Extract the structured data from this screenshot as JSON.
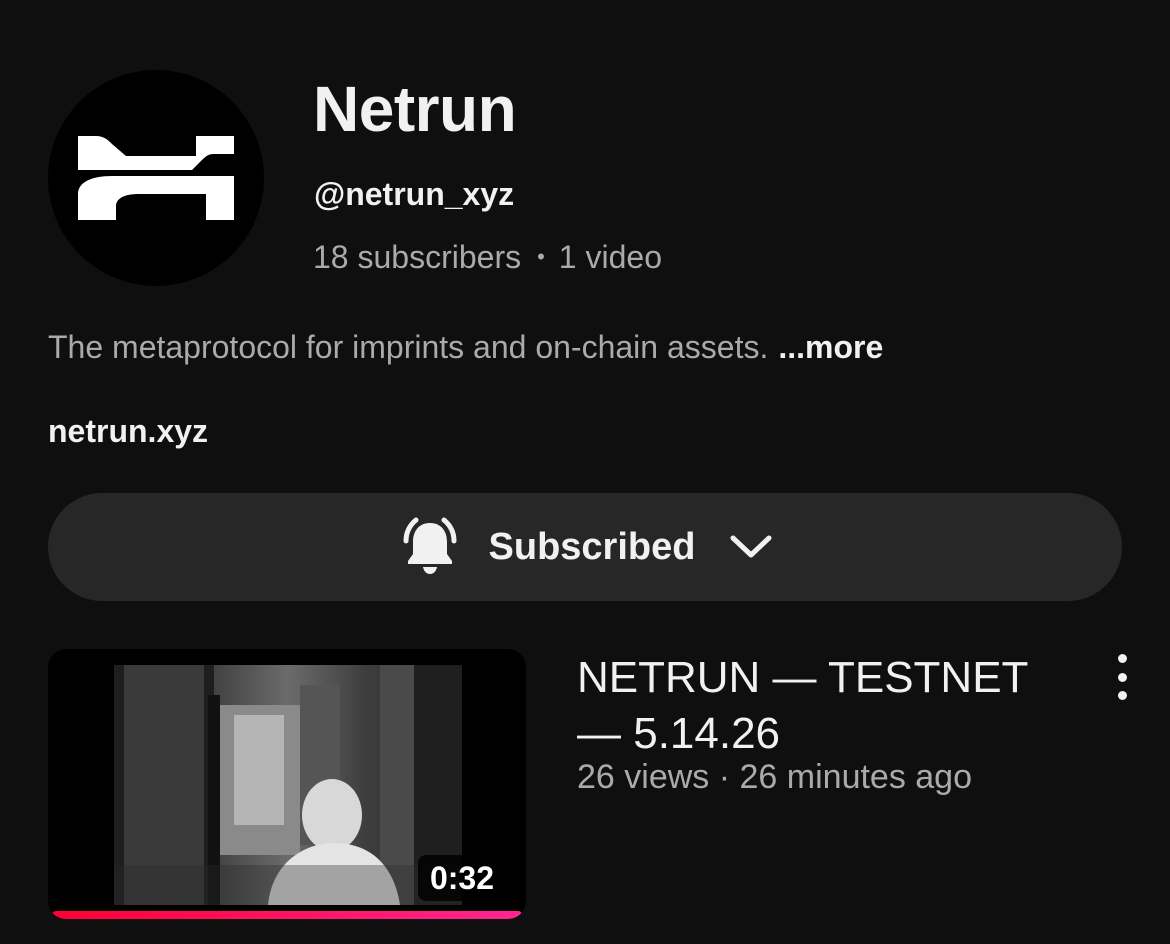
{
  "channel": {
    "name": "Netrun",
    "handle": "@netrun_xyz",
    "subscribers": "18 subscribers",
    "separator": "•",
    "videos": "1 video",
    "description": "The metaprotocol for imprints and on-chain assets.",
    "more_label": "...more",
    "link": "netrun.xyz",
    "avatar_icon": "netrun-logo"
  },
  "subscribe": {
    "label": "Subscribed",
    "bell_icon": "bell-icon",
    "chevron_icon": "chevron-down-icon"
  },
  "video": {
    "title": "NETRUN — TESTNET — 5.14.26",
    "views": "26 views",
    "meta_separator": "·",
    "age": "26 minutes ago",
    "duration": "0:32",
    "watched_fraction": 1.0,
    "menu_icon": "more-vertical-icon"
  },
  "colors": {
    "background": "#0f0f0f",
    "button_bg": "#272727",
    "text_primary": "#f1f1f1",
    "text_secondary": "#aaaaaa",
    "progress": "#ff0033"
  }
}
